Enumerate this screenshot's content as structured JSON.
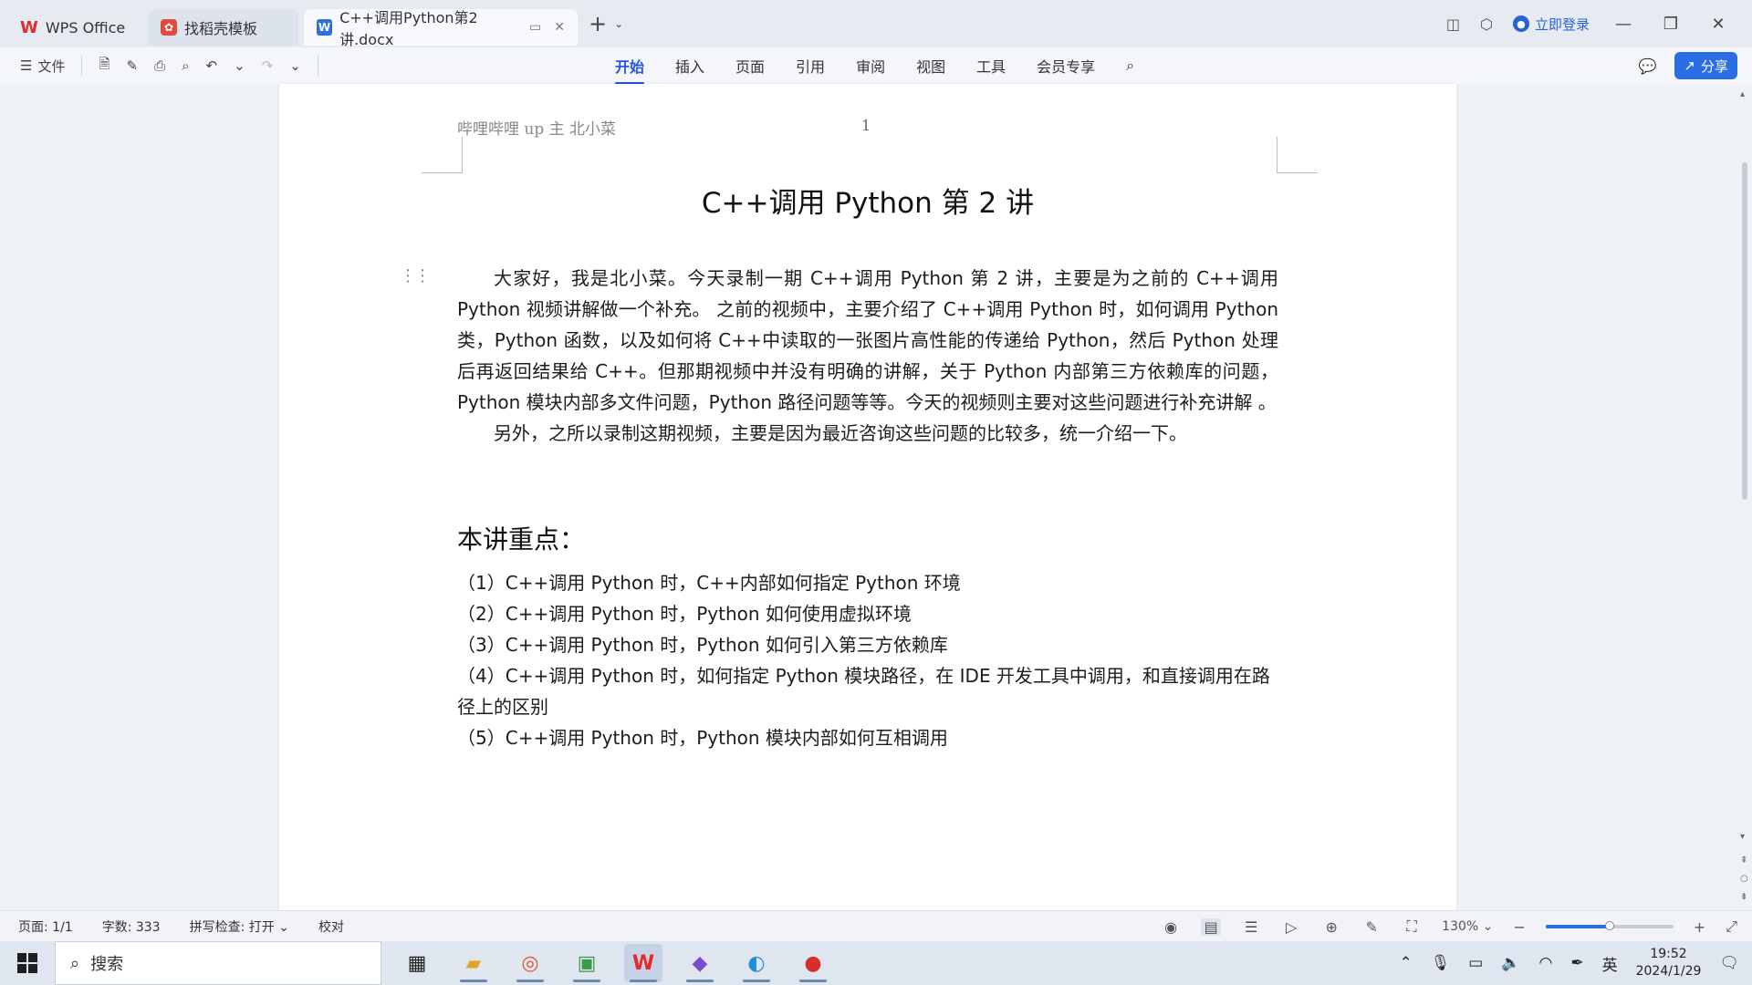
{
  "tabs": [
    {
      "label": "WPS Office",
      "logo": "W"
    },
    {
      "label": "找稻壳模板",
      "logo": "D"
    },
    {
      "label": "C++调用Python第2讲.docx",
      "logo": "W"
    }
  ],
  "header_right": {
    "login_label": "立即登录"
  },
  "ribbon": {
    "file_label": "文件",
    "tabs": [
      "开始",
      "插入",
      "页面",
      "引用",
      "审阅",
      "视图",
      "工具",
      "会员专享"
    ],
    "share_label": "分享"
  },
  "document": {
    "header_text": "哔哩哔哩 up 主 北小菜",
    "page_number": "1",
    "title": "C++调用 Python 第 2 讲",
    "paragraphs": [
      "大家好，我是北小菜。今天录制一期 C++调用 Python 第 2 讲，主要是为之前的 C++调用 Python  视频讲解做一个补充。 之前的视频中，主要介绍了 C++调用 Python 时，如何调用 Python 类，Python 函数，以及如何将 C++中读取的一张图片高性能的传递给 Python，然后 Python 处理后再返回结果给 C++。但那期视频中并没有明确的讲解，关于 Python 内部第三方依赖库的问题，Python 模块内部多文件问题，Python 路径问题等等。今天的视频则主要对这些问题进行补充讲解 。",
      "另外，之所以录制这期视频，主要是因为最近咨询这些问题的比较多，统一介绍一下。"
    ],
    "section_heading": "本讲重点：",
    "points": [
      "（1）C++调用 Python 时，C++内部如何指定 Python 环境",
      "（2）C++调用 Python 时，Python 如何使用虚拟环境",
      "（3）C++调用 Python 时，Python 如何引入第三方依赖库",
      "（4）C++调用 Python 时，如何指定 Python 模块路径，在 IDE 开发工具中调用，和直接调用在路径上的区别",
      "（5）C++调用 Python 时，Python 模块内部如何互相调用"
    ]
  },
  "status": {
    "page": "页面: 1/1",
    "word_count": "字数: 333",
    "spell_check": "拼写检查: 打开",
    "proofread": "校对",
    "zoom": "130%",
    "zoom_fraction": 0.5
  },
  "taskbar": {
    "search_placeholder": "搜索",
    "ime": "英",
    "time": "19:52",
    "date": "2024/1/29"
  },
  "colors": {
    "accent": "#2257d6",
    "share": "#2b6de5",
    "wps_red": "#e22b2b"
  }
}
